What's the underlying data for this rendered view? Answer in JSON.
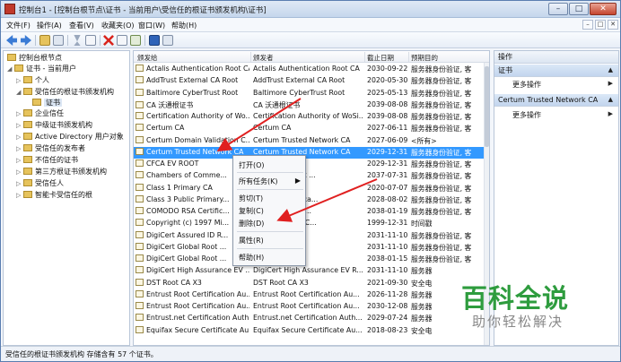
{
  "window": {
    "title": "控制台1 - [控制台根节点\\证书 - 当前用户\\受信任的根证书颁发机构\\证书]",
    "min": "–",
    "max": "□",
    "close": "✕"
  },
  "menubar": {
    "items": [
      "文件(F)",
      "操作(A)",
      "查看(V)",
      "收藏夹(O)",
      "窗口(W)",
      "帮助(H)"
    ],
    "mdi_min": "–",
    "mdi_max": "□",
    "mdi_close": "✕"
  },
  "tree": {
    "items": [
      {
        "label": "控制台根节点"
      },
      {
        "label": "证书 - 当前用户"
      },
      {
        "label": "个人"
      },
      {
        "label": "受信任的根证书颁发机构"
      },
      {
        "label": "证书"
      },
      {
        "label": "企业信任"
      },
      {
        "label": "中级证书颁发机构"
      },
      {
        "label": "Active Directory 用户对象"
      },
      {
        "label": "受信任的发布者"
      },
      {
        "label": "不信任的证书"
      },
      {
        "label": "第三方根证书颁发机构"
      },
      {
        "label": "受信任人"
      },
      {
        "label": "智能卡受信任的根"
      }
    ]
  },
  "list": {
    "columns": [
      "颁发给",
      "颁发者",
      "截止日期",
      "预期目的"
    ],
    "rows": [
      [
        "Actalis Authentication Root CA",
        "Actalis Authentication Root CA",
        "2030-09-22",
        "服务器身份验证, 客"
      ],
      [
        "AddTrust External CA Root",
        "AddTrust External CA Root",
        "2020-05-30",
        "服务器身份验证, 客"
      ],
      [
        "Baltimore CyberTrust Root",
        "Baltimore CyberTrust Root",
        "2025-05-13",
        "服务器身份验证, 客"
      ],
      [
        "CA 沃通根证书",
        "CA 沃通根证书",
        "2039-08-08",
        "服务器身份验证, 客"
      ],
      [
        "Certification Authority of Wo...",
        "Certification Authority of WoSi...",
        "2039-08-08",
        "服务器身份验证, 客"
      ],
      [
        "Certum CA",
        "Certum CA",
        "2027-06-11",
        "服务器身份验证, 客"
      ],
      [
        "Certum Domain Validation C...",
        "Certum Trusted Network CA",
        "2027-06-09",
        "<所有>"
      ],
      [
        "Certum Trusted Network CA",
        "Certum Trusted Network CA",
        "2029-12-31",
        "服务器身份验证, 客"
      ],
      [
        "CFCA EV ROOT",
        "",
        "2029-12-31",
        "服务器身份验证, 客"
      ],
      [
        "Chambers of Comme...",
        "...mmerce Root ...",
        "2037-07-31",
        "服务器身份验证, 客"
      ],
      [
        "Class 1 Primary CA",
        "...CA",
        "2020-07-07",
        "服务器身份验证, 客"
      ],
      [
        "Class 3 Public Primary...",
        "...imary Certifica...",
        "2028-08-02",
        "服务器身份验证, 客"
      ],
      [
        "COMODO RSA Certific...",
        "...Certification ...",
        "2038-01-19",
        "服务器身份验证, 客"
      ],
      [
        "Copyright (c) 1997 Mi...",
        "...97 Microsoft C...",
        "1999-12-31",
        "时间戳"
      ],
      [
        "DigiCert Assured ID R...",
        "...d ID Root CA",
        "2031-11-10",
        "服务器身份验证, 客"
      ],
      [
        "DigiCert Global Root ...",
        "...Root CA",
        "2031-11-10",
        "服务器身份验证, 客"
      ],
      [
        "DigiCert Global Root ...",
        "...Root G2",
        "2038-01-15",
        "服务器身份验证, 客"
      ],
      [
        "DigiCert High Assurance EV ...",
        "DigiCert High Assurance EV R...",
        "2031-11-10",
        "服务器"
      ],
      [
        "DST Root CA X3",
        "DST Root CA X3",
        "2021-09-30",
        "安全电"
      ],
      [
        "Entrust Root Certification Au...",
        "Entrust Root Certification Au...",
        "2026-11-28",
        "服务器"
      ],
      [
        "Entrust Root Certification Au...",
        "Entrust Root Certification Au...",
        "2030-12-08",
        "服务器"
      ],
      [
        "Entrust.net Certification Auth...",
        "Entrust.net Certification Auth...",
        "2029-07-24",
        "服务器"
      ],
      [
        "Equifax Secure Certificate Au...",
        "Equifax Secure Certificate Au...",
        "2018-08-23",
        "安全电"
      ]
    ]
  },
  "actions": {
    "header": "操作",
    "section1": "证书",
    "section1_more": "更多操作",
    "section2": "Certum Trusted Network CA",
    "section2_more": "更多操作",
    "caret": "▶"
  },
  "context_menu": {
    "open": "打开(O)",
    "all_tasks": "所有任务(K)",
    "cut": "剪切(T)",
    "copy": "复制(C)",
    "delete": "删除(D)",
    "properties": "属性(R)",
    "help": "帮助(H)",
    "submenu_caret": "▶"
  },
  "status": {
    "text": "受信任的根证书颁发机构 存储含有 57 个证书。"
  },
  "watermark": {
    "brand": "百科全说",
    "slogan": "助你轻松解决"
  },
  "colors": {
    "selection": "#3399ff",
    "arrow": "#e02020",
    "watermark": "#2e9c3e"
  }
}
